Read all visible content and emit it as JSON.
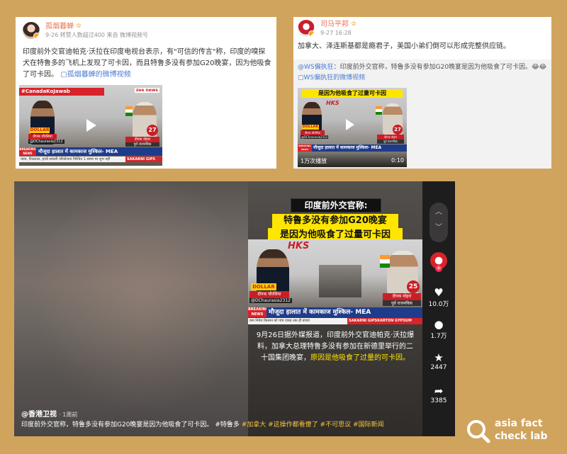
{
  "post1": {
    "username": "孤烟暮蝉",
    "crown": "♔",
    "meta": "9-26 转赞人数超过400 来自 微博视频号",
    "text": "印度前外交官迪帕克·沃拉在印度电视台表示，有\"可信的传言\"称，印度的嗅探犬在特鲁多的飞机上发现了可卡因，而且特鲁多没有参加G20晚宴，因为他吸食了可卡因。",
    "link_label": "孤烟暮蝉的微博视频",
    "link_icon": "▢",
    "thumb": {
      "hashtag": "#CanadaKoJawab",
      "channel": "zee news",
      "dollar": "DOLLAR",
      "name_left": "दीपक चौरसिया",
      "handle_left": "@DChaurasia2312",
      "badge": "27",
      "name_right": "दीपक वोहरा",
      "title_right": "पूर्व राजनयिक",
      "breaking": "BREAKING NEWS",
      "headline": "मौजूदा हालात में कामकाज मुश्किल- MEA",
      "ticker": "न्याय, रियल्टाल, हाथी सफारी परियोजना निश्चित 1 समय पर शुभ नहीं",
      "sponsor": "SAKARNI GIPS"
    }
  },
  "post2": {
    "username": "司马平邦",
    "crown": "♔",
    "meta": "9-27 16:28",
    "text": "加拿大、泽连斯基都是瘾君子，美国小弟们倒可以形成完整供应链。",
    "quote_user": "@WS偏执狂",
    "quote_text": "：印度前外交官称，特鲁多没有参加G20晚宴是因为他吸食了可卡因。",
    "quote_emoji": "😂😂",
    "link_label": "WS偏执狂的微博视频",
    "link_icon": "▢",
    "thumb": {
      "overlay": "是因为他吸食了过量可卡因",
      "hks": "HKS",
      "dollar": "DOLLAR",
      "name_left": "दीपक चौरसिया",
      "handle_left": "@DChaurasia2312",
      "badge": "27",
      "name_right": "दीपक वोहरा",
      "title_right": "पूर्व राजनयिक",
      "breaking": "BREAKING NEWS",
      "headline": "मौजूदा हालात में कामकाज मुश्किल- MEA",
      "views": "1万次播放",
      "duration": "0:10"
    }
  },
  "video": {
    "title_line1": "印度前外交官称:",
    "title_line2": "特鲁多没有参加G20晚宴",
    "title_line3": "是因为他吸食了过量可卡因",
    "hks": "HKS",
    "dollar": "DOLLAR",
    "name_left": "दीपक चौरसिया",
    "handle_left": "@DChaurasia2312",
    "badge": "25",
    "name_right": "दीपक वोहरा",
    "title_right": "पूर्व राजनयिक",
    "breaking": "BREAKING NEWS",
    "headline": "मौजूदा हालात में कामकाज मुश्किल- MEA",
    "ticker": "कम निवेश किसान को पांच एकड़ तक ही बचाव",
    "sponsor": "SAKARNI GIPSKARTON GYPSUM",
    "subtitle_white": "9月26日据外媒报道，印度前外交官迪帕克·沃拉爆料，加拿大总理特鲁多没有参加在新德里举行的二十国集团晚宴，",
    "subtitle_yellow": "原因是他吸食了过量的可卡因。",
    "account": "@香港卫视",
    "time": "· 1周前",
    "caption": "印度前外交官称，特鲁多没有参加G20晚宴是因为他吸食了可卡因。",
    "tags": [
      "#特鲁多",
      "#加拿大",
      "#这操作都看傻了",
      "#不可思议",
      "#国际新闻"
    ],
    "likes": "10.0万",
    "comments": "1.7万",
    "favorites": "2447",
    "shares": "3385",
    "add_icon": "+"
  },
  "watermark": {
    "line1": "asia fact",
    "line2": "check lab"
  },
  "colors": {
    "background": "#d1a45e",
    "weibo_orange": "#eb7350",
    "link_blue": "#4a7bd0",
    "highlight_yellow": "#ffe600"
  }
}
